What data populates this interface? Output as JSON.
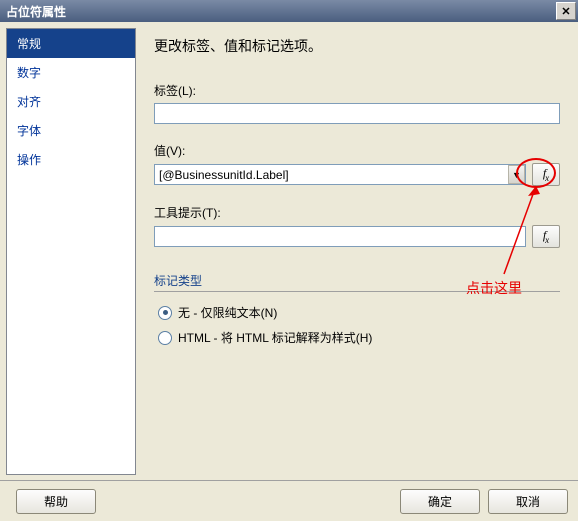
{
  "title": "占位符属性",
  "sidebar": {
    "items": [
      {
        "label": "常规"
      },
      {
        "label": "数字"
      },
      {
        "label": "对齐"
      },
      {
        "label": "字体"
      },
      {
        "label": "操作"
      }
    ],
    "selected_index": 0
  },
  "main": {
    "heading": "更改标签、值和标记选项。",
    "label_field": {
      "label": "标签(L):",
      "value": ""
    },
    "value_field": {
      "label": "值(V):",
      "value": "[@BusinessunitId.Label]"
    },
    "tooltip_field": {
      "label": "工具提示(T):",
      "value": ""
    },
    "markup_group": {
      "legend": "标记类型",
      "options": [
        {
          "label": "无 - 仅限纯文本(N)",
          "checked": true
        },
        {
          "label": "HTML - 将 HTML 标记解释为样式(H)",
          "checked": false
        }
      ]
    }
  },
  "buttons": {
    "help": "帮助",
    "ok": "确定",
    "cancel": "取消",
    "fx": "f"
  },
  "annotation": {
    "text": "点击这里"
  }
}
